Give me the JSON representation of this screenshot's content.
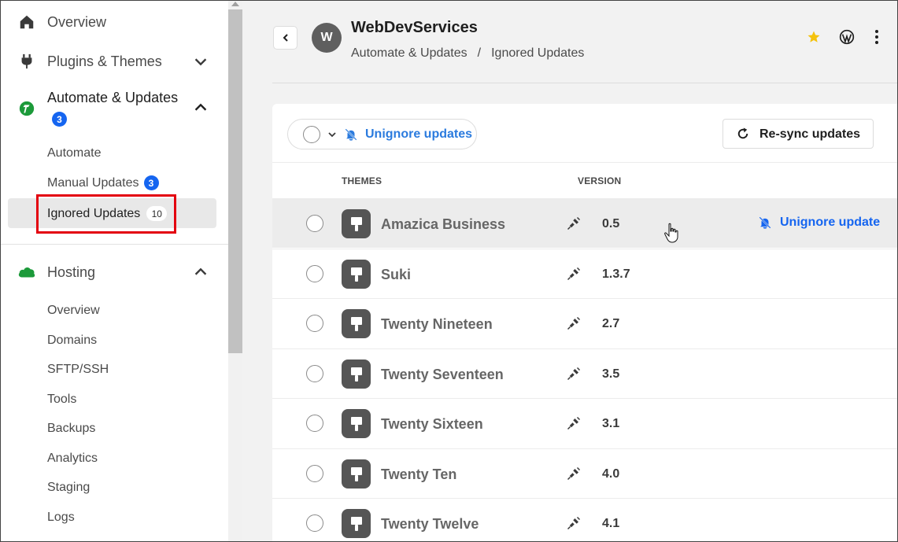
{
  "sidebar": {
    "overview": "Overview",
    "plugins_themes": "Plugins & Themes",
    "automate_updates": "Automate & Updates",
    "automate_badge": "3",
    "sub": {
      "automate": "Automate",
      "manual_updates": "Manual Updates",
      "manual_badge": "3",
      "ignored_updates": "Ignored Updates",
      "ignored_badge": "10"
    },
    "hosting": "Hosting",
    "hosting_items": [
      "Overview",
      "Domains",
      "SFTP/SSH",
      "Tools",
      "Backups",
      "Analytics",
      "Staging",
      "Logs"
    ]
  },
  "header": {
    "avatar_letter": "W",
    "site_name": "WebDevServices",
    "breadcrumb": [
      "Automate & Updates",
      "/",
      "Ignored Updates"
    ]
  },
  "toolbar": {
    "unignore_updates": "Unignore updates",
    "resync_updates": "Re-sync updates"
  },
  "table": {
    "columns": [
      "THEMES",
      "VERSION"
    ],
    "rows": [
      {
        "name": "Amazica Business",
        "version": "0.5",
        "action": "Unignore update"
      },
      {
        "name": "Suki",
        "version": "1.3.7"
      },
      {
        "name": "Twenty Nineteen",
        "version": "2.7"
      },
      {
        "name": "Twenty Seventeen",
        "version": "3.5"
      },
      {
        "name": "Twenty Sixteen",
        "version": "3.1"
      },
      {
        "name": "Twenty Ten",
        "version": "4.0"
      },
      {
        "name": "Twenty Twelve",
        "version": "4.1"
      }
    ]
  },
  "colors": {
    "accent_blue": "#1565f0",
    "highlight_red": "#e3000f",
    "star_yellow": "#f4c20d",
    "brand_green": "#1c9a3a"
  }
}
